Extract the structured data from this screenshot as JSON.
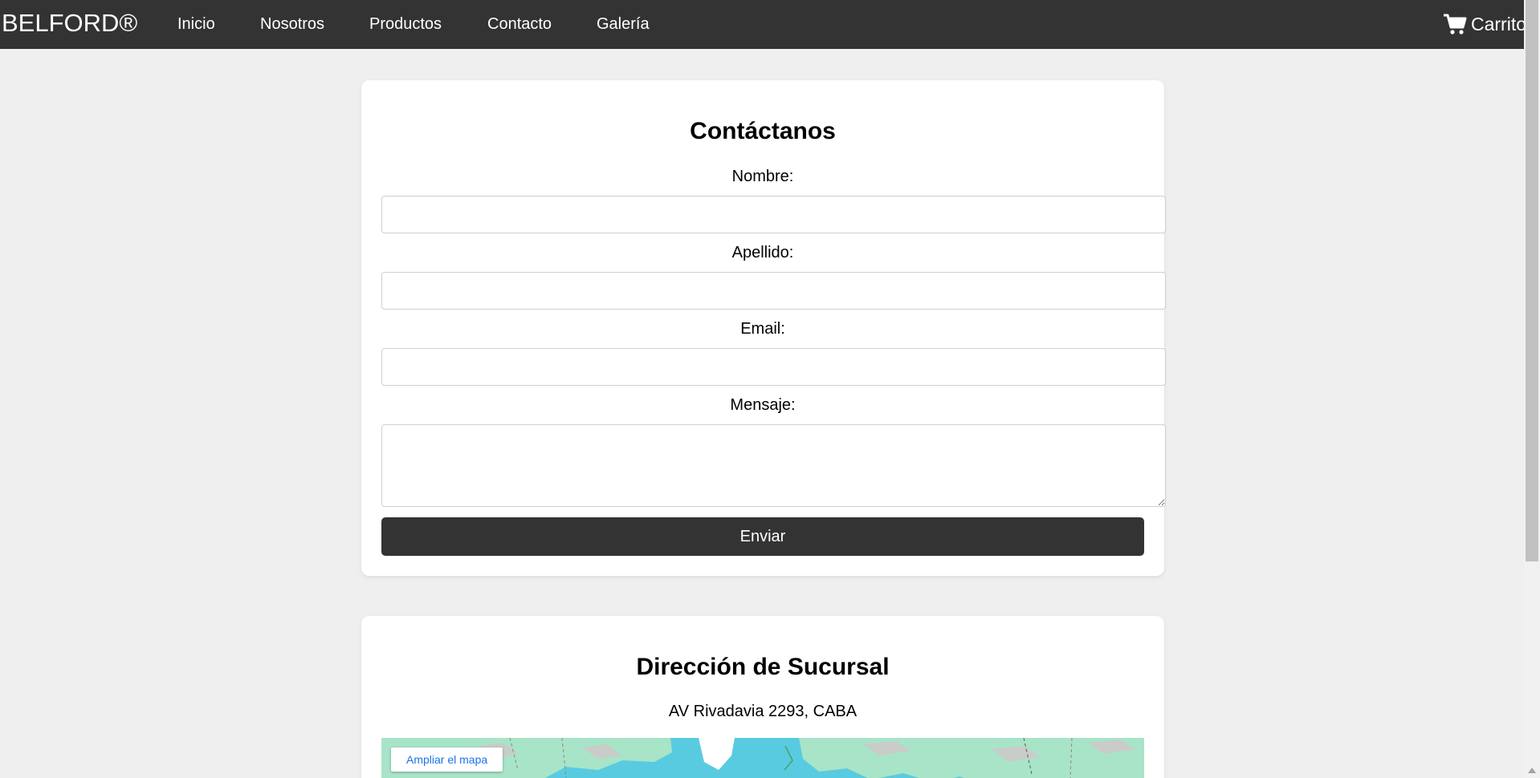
{
  "nav": {
    "brand": "BELFORD®",
    "links": [
      "Inicio",
      "Nosotros",
      "Productos",
      "Contacto",
      "Galería"
    ],
    "cart_label": "Carrito",
    "cart_icon": "cart-icon"
  },
  "contact_form": {
    "title": "Contáctanos",
    "fields": [
      {
        "label": "Nombre:",
        "value": "",
        "placeholder": ""
      },
      {
        "label": "Apellido:",
        "value": "",
        "placeholder": ""
      },
      {
        "label": "Email:",
        "value": "",
        "placeholder": ""
      },
      {
        "label": "Mensaje:",
        "value": "",
        "placeholder": ""
      }
    ],
    "submit_label": "Enviar"
  },
  "branch": {
    "title": "Dirección de Sucursal",
    "address": "AV Rivadavia 2293, CABA",
    "map_button_label": "Ampliar el mapa"
  },
  "colors": {
    "navbar": "#333333",
    "background": "#efefef",
    "card": "#ffffff",
    "button": "#333333",
    "map_water": "#59cbe0",
    "map_land": "#a8e4c8",
    "map_link": "#1a73e8"
  }
}
